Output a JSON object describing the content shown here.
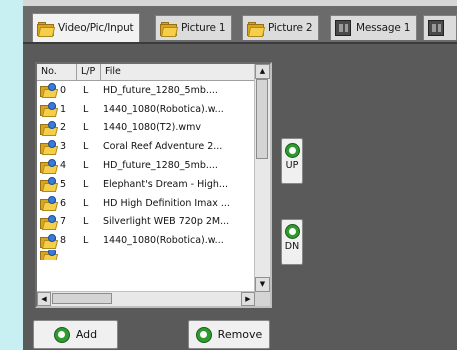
{
  "tabs": [
    {
      "label": "Video/Pic/Input",
      "icon": "folder-icon",
      "active": true
    },
    {
      "label": "Picture 1",
      "icon": "folder-icon",
      "active": false
    },
    {
      "label": "Picture 2",
      "icon": "folder-icon",
      "active": false
    },
    {
      "label": "Message 1",
      "icon": "message-icon",
      "active": false
    }
  ],
  "list": {
    "headers": {
      "no": "No.",
      "lp": "L/P",
      "file": "File"
    },
    "rows": [
      {
        "no": "0",
        "lp": "L",
        "file": "HD_future_1280_5mb...."
      },
      {
        "no": "1",
        "lp": "L",
        "file": "1440_1080(Robotica).w..."
      },
      {
        "no": "2",
        "lp": "L",
        "file": "1440_1080(T2).wmv"
      },
      {
        "no": "3",
        "lp": "L",
        "file": "Coral Reef Adventure 2..."
      },
      {
        "no": "4",
        "lp": "L",
        "file": "HD_future_1280_5mb...."
      },
      {
        "no": "5",
        "lp": "L",
        "file": "Elephant's Dream - High..."
      },
      {
        "no": "6",
        "lp": "L",
        "file": "HD High Definition Imax ..."
      },
      {
        "no": "7",
        "lp": "L",
        "file": "Silverlight WEB 720p 2M..."
      },
      {
        "no": "8",
        "lp": "L",
        "file": "1440_1080(Robotica).w..."
      }
    ]
  },
  "buttons": {
    "up": "UP",
    "dn": "DN",
    "add": "Add",
    "remove": "Remove"
  },
  "colors": {
    "page_bg": "#c8f0f2",
    "panel_bg": "#5a5a5a",
    "green_icon": "#2f9a2f",
    "folder_yellow": "#f5cf4a"
  }
}
